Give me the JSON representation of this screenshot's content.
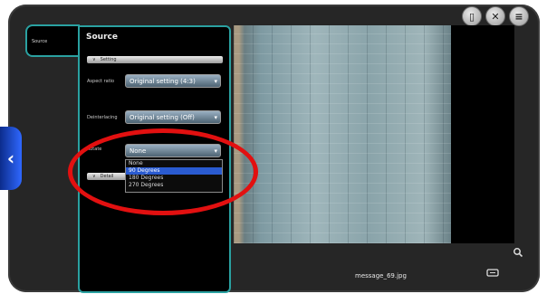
{
  "window": {
    "top_icons": [
      {
        "icon": "document-icon",
        "glyph": "▯"
      },
      {
        "icon": "close-icon",
        "glyph": "✕"
      },
      {
        "icon": "menu-icon",
        "glyph": "≡"
      }
    ],
    "back_glyph": "‹"
  },
  "sidebar": {
    "tab_label": "Source"
  },
  "panel": {
    "title": "Source",
    "sections": {
      "setting": {
        "label": "Setting",
        "chevron": "∨"
      },
      "detail": {
        "label": "Detail",
        "chevron": "∨"
      }
    },
    "rows": {
      "aspect_ratio": {
        "label": "Aspect ratio",
        "value": "Original setting (4:3)"
      },
      "deinterlacing": {
        "label": "Deinterlacing",
        "value": "Original setting (Off)"
      },
      "rotate": {
        "label": "Rotate",
        "value": "None"
      }
    },
    "rotate_options": [
      "None",
      "90 Degrees",
      "180 Degrees",
      "270 Degrees"
    ],
    "rotate_highlighted_index": 1
  },
  "viewer": {
    "filename": "message_69.jpg",
    "search_icon": "magnifier-icon",
    "cast_icon": "screen-icon"
  },
  "annotation": {
    "color": "#e21010"
  }
}
